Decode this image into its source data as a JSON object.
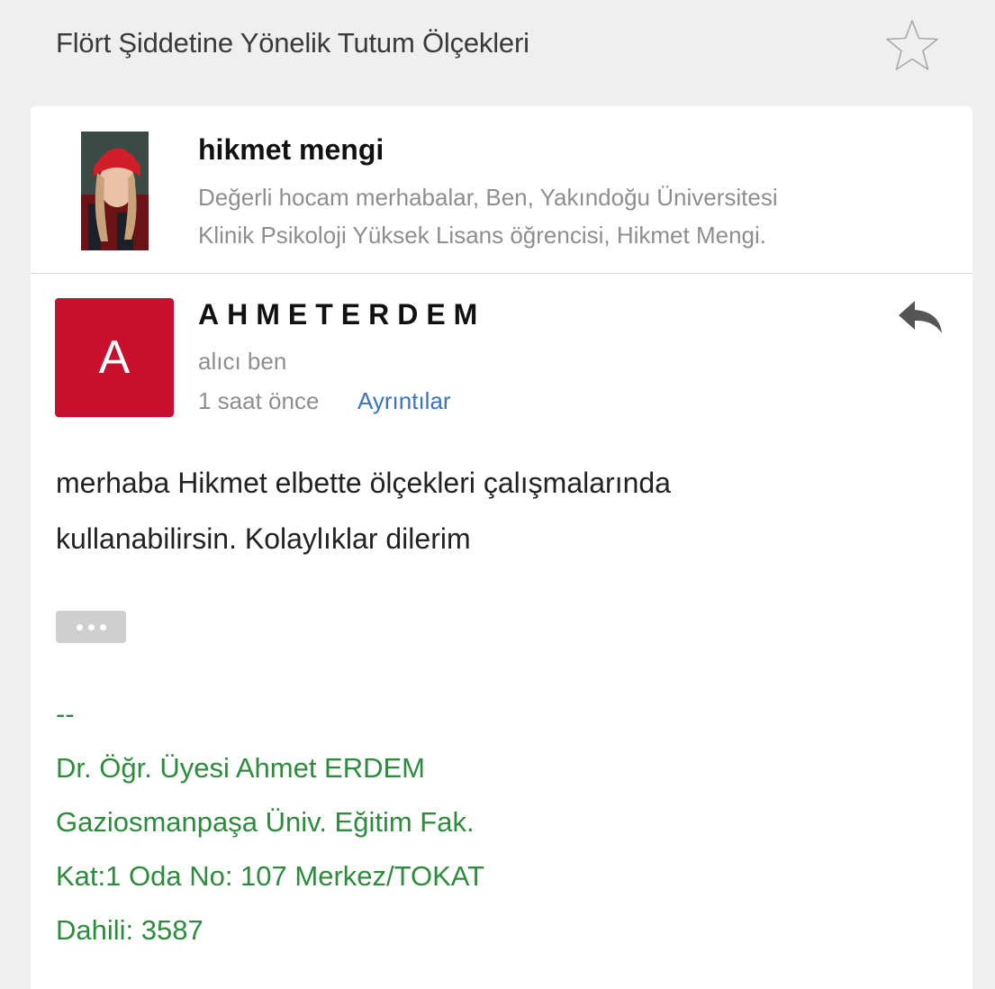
{
  "header": {
    "subject": "Flört Şiddetine Yönelik Tutum Ölçekleri"
  },
  "previous_message": {
    "sender": "hikmet mengi",
    "snippet": "Değerli hocam merhabalar, Ben, Yakındoğu Üniversitesi\nKlinik Psikoloji Yüksek Lisans öğrencisi, Hikmet Mengi."
  },
  "message": {
    "avatar_letter": "A",
    "avatar_color": "#c8102e",
    "sender": "AHMETERDEM",
    "recipient": "alıcı ben",
    "time": "1 saat önce",
    "details_label": "Ayrıntılar",
    "body": "merhaba Hikmet elbette ölçekleri çalışmalarında\nkullanabilirsin. Kolaylıklar dilerim",
    "signature": {
      "separator": "--",
      "line1": "Dr. Öğr. Üyesi Ahmet ERDEM",
      "line2": "Gaziosmanpaşa Üniv. Eğitim Fak.",
      "line3": "Kat:1 Oda No: 107 Merkez/TOKAT",
      "line4": "Dahili: 3587"
    }
  },
  "colors": {
    "link": "#3b73c2",
    "signature": "#2e8b3e"
  },
  "icons": {
    "star": "star-icon",
    "reply": "reply-icon",
    "more": "ellipsis-icon"
  }
}
